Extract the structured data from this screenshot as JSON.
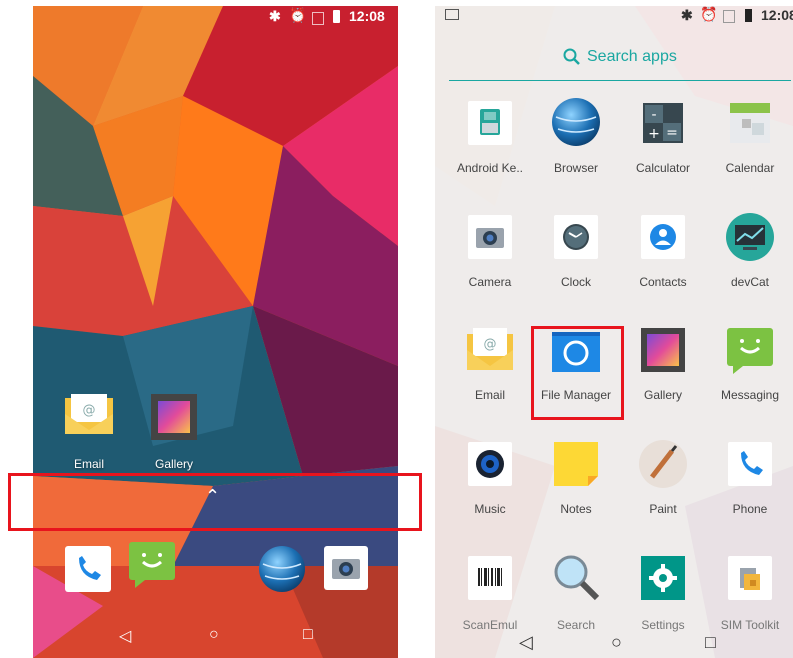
{
  "left": {
    "status_time": "12:08",
    "home_apps": [
      {
        "label": "Email",
        "icon": "email-icon"
      },
      {
        "label": "Gallery",
        "icon": "gallery-icon"
      }
    ],
    "dock_apps": [
      "phone-icon",
      "messaging-icon",
      "browser-icon",
      "camera-icon"
    ],
    "drawer_handle_glyph": "⌃"
  },
  "right": {
    "status_time": "12:08",
    "search_placeholder": "Search apps",
    "apps": [
      {
        "label": "Android Ke..",
        "icon": "keyboard-icon"
      },
      {
        "label": "Browser",
        "icon": "browser-icon"
      },
      {
        "label": "Calculator",
        "icon": "calculator-icon"
      },
      {
        "label": "Calendar",
        "icon": "calendar-icon"
      },
      {
        "label": "Camera",
        "icon": "camera-icon"
      },
      {
        "label": "Clock",
        "icon": "clock-icon"
      },
      {
        "label": "Contacts",
        "icon": "contacts-icon"
      },
      {
        "label": "devCat",
        "icon": "devcat-icon"
      },
      {
        "label": "Email",
        "icon": "email-icon"
      },
      {
        "label": "File Manager",
        "icon": "file-manager-icon"
      },
      {
        "label": "Gallery",
        "icon": "gallery-icon"
      },
      {
        "label": "Messaging",
        "icon": "messaging-icon"
      },
      {
        "label": "Music",
        "icon": "music-icon"
      },
      {
        "label": "Notes",
        "icon": "notes-icon"
      },
      {
        "label": "Paint",
        "icon": "paint-icon"
      },
      {
        "label": "Phone",
        "icon": "phone-icon"
      },
      {
        "label": "ScanEmul",
        "icon": "barcode-icon"
      },
      {
        "label": "Search",
        "icon": "magnifier-icon"
      },
      {
        "label": "Settings",
        "icon": "settings-icon"
      },
      {
        "label": "SIM Toolkit",
        "icon": "sim-toolkit-icon"
      }
    ]
  },
  "colors": {
    "highlight": "#e8141d",
    "accent": "#1aa7a1"
  }
}
